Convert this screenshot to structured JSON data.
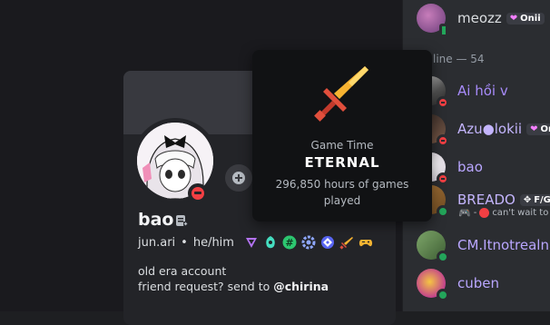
{
  "members": [
    {
      "name": "meozz",
      "badge": "Onii",
      "color": "#dbdee1"
    },
    {
      "name": "Ai hồi v",
      "color": "#a78bfa"
    },
    {
      "name": "Azu●lokii",
      "badge": "Oni",
      "color": "#c4b5fd"
    },
    {
      "name": "bao",
      "color": "#b9a6ff"
    },
    {
      "name": "BREADO",
      "badge": "F/G",
      "color": "#c4b5fd"
    },
    {
      "name": "CM.Itnotrealna",
      "color": "#b9a6ff"
    },
    {
      "name": "cuben",
      "color": "#b9a6ff"
    }
  ],
  "section_header": "line — 54",
  "activity_text": "can't wait to",
  "profile": {
    "display_name": "bao",
    "username": "jun.ari",
    "separator": "•",
    "pronouns": "he/him",
    "bio_line1": "old era account",
    "bio_line2_prefix": "friend request? send to ",
    "bio_mention": "@chirina"
  },
  "tooltip": {
    "label": "Game Time",
    "title": "ETERNAL",
    "description": "296,850 hours of games played"
  },
  "colors": {
    "dnd": "#f23f43",
    "online": "#23a55a",
    "accent": "#5865f2"
  }
}
